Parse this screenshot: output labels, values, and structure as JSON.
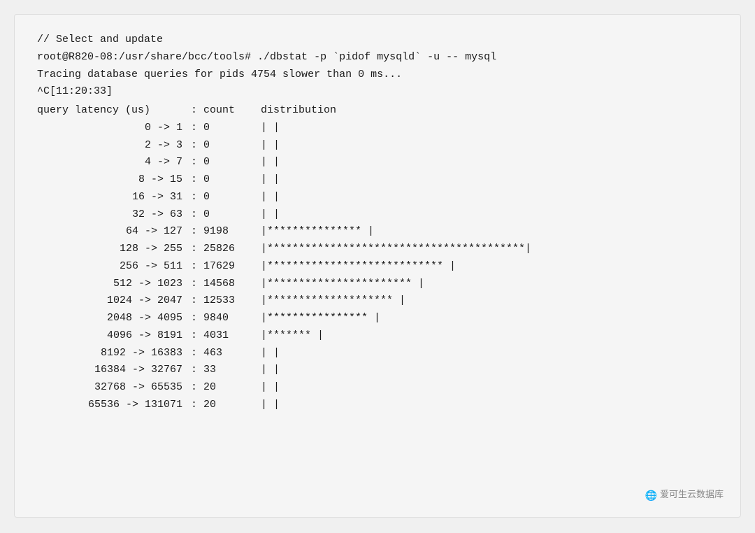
{
  "terminal": {
    "lines": [
      "// Select and update",
      "root@R820-08:/usr/share/bcc/tools# ./dbstat -p `pidof mysqld` -u -- mysql",
      "Tracing database queries for pids 4754 slower than 0 ms...",
      "^C[11:20:33]"
    ],
    "table_header": {
      "range": "query latency (us)",
      "count": ": count",
      "dist": "    distribution"
    },
    "rows": [
      {
        "range": "0 -> 1",
        "count": ": 0",
        "dist": "|                                                  |"
      },
      {
        "range": "2 -> 3",
        "count": ": 0",
        "dist": "|                                                  |"
      },
      {
        "range": "4 -> 7",
        "count": ": 0",
        "dist": "|                                                  |"
      },
      {
        "range": "8 -> 15",
        "count": ": 0",
        "dist": "|                                                  |"
      },
      {
        "range": "16 -> 31",
        "count": ": 0",
        "dist": "|                                                  |"
      },
      {
        "range": "32 -> 63",
        "count": ": 0",
        "dist": "|                                                  |"
      },
      {
        "range": "64 -> 127",
        "count": ": 9198",
        "dist": "|***************                                   |"
      },
      {
        "range": "128 -> 255",
        "count": ": 25826",
        "dist": "|*****************************************|"
      },
      {
        "range": "256 -> 511",
        "count": ": 17629",
        "dist": "|****************************              |"
      },
      {
        "range": "512 -> 1023",
        "count": ": 14568",
        "dist": "|***********************                   |"
      },
      {
        "range": "1024 -> 2047",
        "count": ": 12533",
        "dist": "|********************                      |"
      },
      {
        "range": "2048 -> 4095",
        "count": ": 9840",
        "dist": "|****************                          |"
      },
      {
        "range": "4096 -> 8191",
        "count": ": 4031",
        "dist": "|*******                                   |"
      },
      {
        "range": "8192 -> 16383",
        "count": ": 463",
        "dist": "|                                          |"
      },
      {
        "range": "16384 -> 32767",
        "count": ": 33",
        "dist": "|                                          |"
      },
      {
        "range": "32768 -> 65535",
        "count": ": 20",
        "dist": "|                                          |"
      },
      {
        "range": "65536 -> 131071",
        "count": ": 20",
        "dist": "|                                          |"
      }
    ],
    "watermark": "爱可生云数据库"
  }
}
